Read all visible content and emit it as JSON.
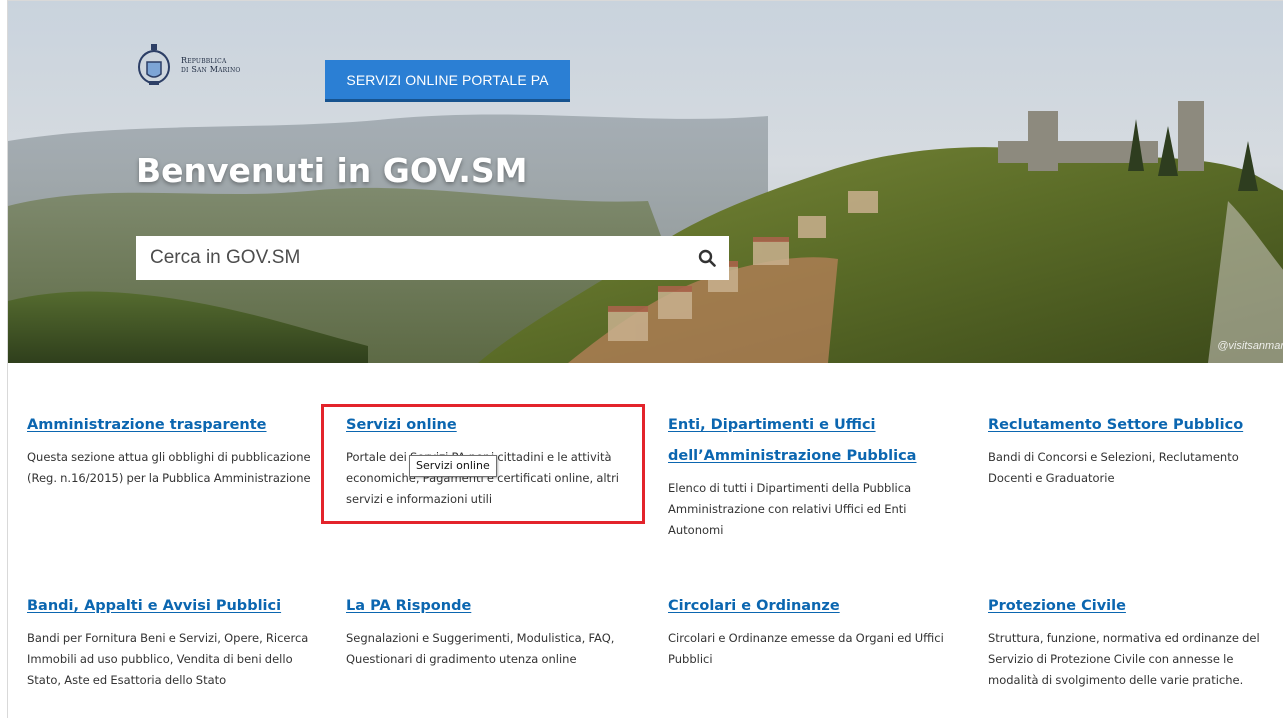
{
  "header": {
    "logo_line1": "Repubblica",
    "logo_line2": "di San Marino",
    "cta_label": "SERVIZI ONLINE PORTALE PA"
  },
  "hero": {
    "title": "Benvenuti in GOV.SM",
    "search_placeholder": "Cerca in GOV.SM",
    "photo_credit": "@visitsanmar"
  },
  "cards": [
    {
      "title": "Amministrazione trasparente",
      "desc": "Questa sezione attua gli obblighi di pubblicazione (Reg. n.16/2015) per la Pubblica Amministrazione"
    },
    {
      "title": "Servizi online",
      "desc": "Portale dei Servizi PA per i cittadini e le attività economiche, Pagamenti e certificati online, altri servizi e informazioni utili"
    },
    {
      "title": "Enti, Dipartimenti e Uffici dell’Amministrazione Pubblica",
      "desc": "Elenco di tutti i Dipartimenti della Pubblica Amministrazione con relativi Uffici ed Enti Autonomi"
    },
    {
      "title": "Reclutamento Settore Pubblico",
      "desc": "Bandi di Concorsi e Selezioni, Reclutamento Docenti e Graduatorie"
    },
    {
      "title": "Bandi, Appalti e Avvisi Pubblici",
      "desc": "Bandi per Fornitura Beni e Servizi, Opere, Ricerca Immobili ad uso pubblico, Vendita di beni dello Stato, Aste ed Esattoria dello Stato"
    },
    {
      "title": "La PA Risponde",
      "desc": "Segnalazioni e Suggerimenti, Modulistica, FAQ, Questionari di gradimento utenza online"
    },
    {
      "title": "Circolari e Ordinanze",
      "desc": "Circolari e Ordinanze emesse da Organi ed Uffici Pubblici"
    },
    {
      "title": "Protezione Civile",
      "desc": "Struttura, funzione, normativa ed ordinanze del Servizio di Protezione Civile con annesse le modalità di svolgimento delle varie pratiche."
    }
  ],
  "tooltip": "Servizi online",
  "colors": {
    "cta": "#2b7fd4",
    "link": "#0b66b0",
    "highlight": "#e3232b"
  }
}
